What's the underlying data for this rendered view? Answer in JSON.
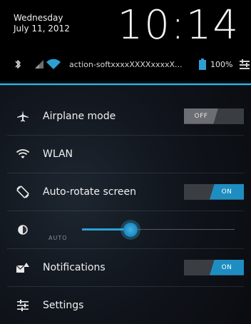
{
  "header": {
    "day": "Wednesday",
    "date": "July 11, 2012",
    "time": "10:14"
  },
  "status_bar": {
    "ssid": "action-softxxxxXXXXxxxxX...",
    "battery_pct": "100%",
    "icons": [
      "bluetooth-icon",
      "signal-icon",
      "wifi-icon",
      "battery-icon",
      "settings-shortcut-icon"
    ]
  },
  "rows": [
    {
      "icon": "airplane-icon",
      "label": "Airplane mode",
      "toggle": "OFF",
      "state": "off"
    },
    {
      "icon": "wifi-icon",
      "label": "WLAN"
    },
    {
      "icon": "rotate-icon",
      "label": "Auto-rotate screen",
      "toggle": "ON",
      "state": "on"
    },
    {
      "icon": "brightness-icon",
      "auto_label": "AUTO",
      "brightness_level": 0.32
    },
    {
      "icon": "notifications-icon",
      "label": "Notifications",
      "toggle": "ON",
      "state": "on"
    },
    {
      "icon": "settings-sliders-icon",
      "label": "Settings"
    }
  ],
  "colors": {
    "accent": "#31b6e7",
    "toggle_on": "#1e8dc1",
    "toggle_off": "#6b6e72"
  }
}
